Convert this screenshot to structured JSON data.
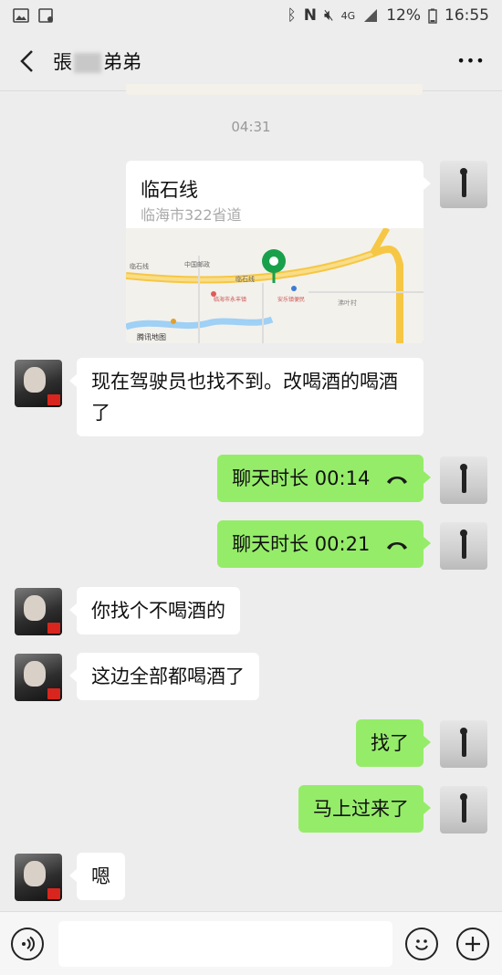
{
  "status_bar": {
    "battery": "12%",
    "time": "16:55",
    "network": "4G"
  },
  "header": {
    "title_first": "張",
    "title_last": "弟弟",
    "more_label": "•••"
  },
  "timestamp": "04:31",
  "location": {
    "name": "临石线",
    "address": "临海市322省道",
    "map_labels": {
      "road": "临石线",
      "post": "中国邮政",
      "village": "沸叶村",
      "brand": "腾讯地图",
      "poi_a": "临海市永丰镇",
      "poi_b": "安乐镇便民"
    }
  },
  "messages": [
    {
      "from": "peer",
      "text": "现在驾驶员也找不到。改喝酒的喝酒了"
    },
    {
      "from": "self",
      "type": "call",
      "text": "聊天时长 00:14"
    },
    {
      "from": "self",
      "type": "call",
      "text": "聊天时长 00:21"
    },
    {
      "from": "peer",
      "text": "你找个不喝酒的"
    },
    {
      "from": "peer",
      "text": "这边全部都喝酒了"
    },
    {
      "from": "self",
      "text": "找了"
    },
    {
      "from": "self",
      "text": "马上过来了"
    },
    {
      "from": "peer",
      "text": "嗯"
    }
  ],
  "colors": {
    "background": "#ededed",
    "self_bubble": "#95ec69",
    "peer_bubble": "#ffffff",
    "map_pin": "#19a04b"
  }
}
